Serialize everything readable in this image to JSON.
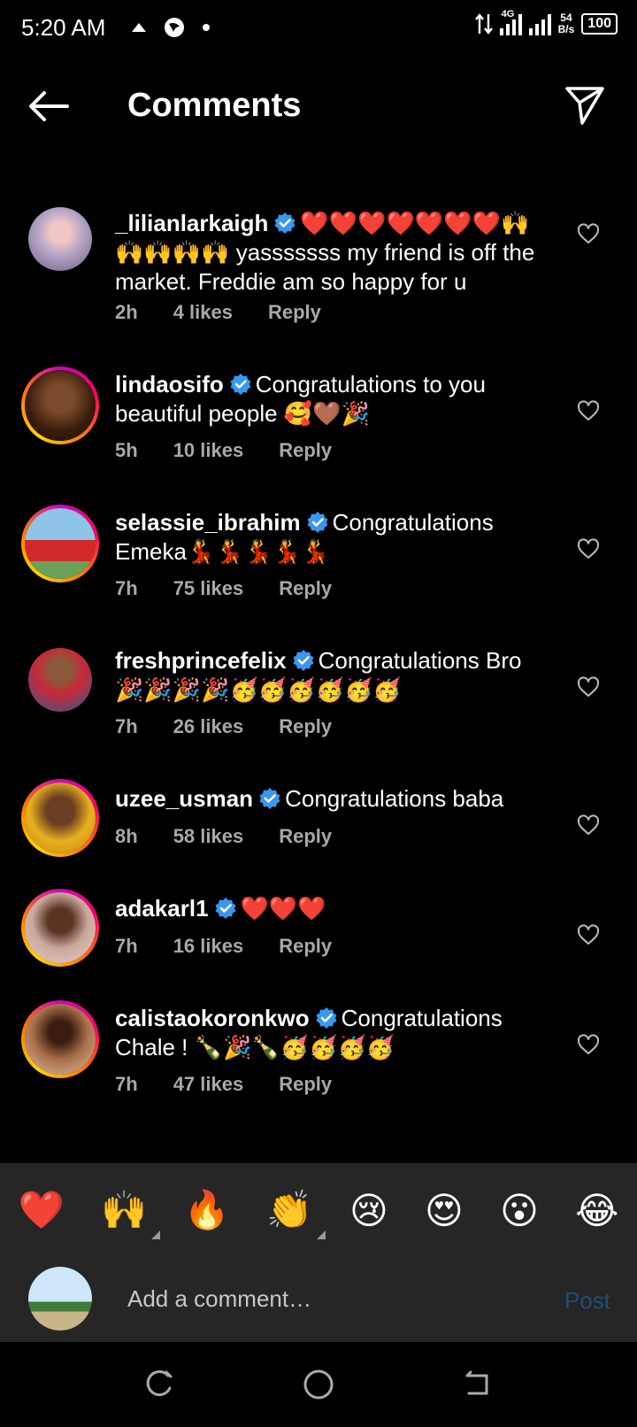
{
  "status_bar": {
    "time": "5:20 AM",
    "network": "4G",
    "speed_top": "54",
    "speed_bottom": "B/s",
    "battery": "100"
  },
  "header": {
    "title": "Comments",
    "back_icon": "arrow-left-icon",
    "share_icon": "paper-plane-icon"
  },
  "colors": {
    "verified": "#3897f0",
    "story_ring": "#d300c5",
    "reaction_bar": "#262626",
    "post": "#1d4d7a"
  },
  "comments": [
    {
      "username": "_lilianlarkaigh",
      "text": "❤️❤️❤️❤️❤️❤️❤️🙌🙌🙌🙌🙌 yasssssss my friend  is off the market. Freddie am so happy for u",
      "time": "2h",
      "likes": "4 likes",
      "reply": "Reply"
    },
    {
      "username": "lindaosifo",
      "text": "Congratulations to you beautiful people 🥰🤎🎉",
      "time": "5h",
      "likes": "10 likes",
      "reply": "Reply"
    },
    {
      "username": "selassie_ibrahim",
      "text": "Congratulations Emeka💃💃💃💃💃",
      "time": "7h",
      "likes": "75 likes",
      "reply": "Reply"
    },
    {
      "username": "freshprincefelix",
      "text": "Congratulations Bro 🎉🎉🎉🎉🥳🥳🥳🥳🥳🥳",
      "time": "7h",
      "likes": "26 likes",
      "reply": "Reply"
    },
    {
      "username": "uzee_usman",
      "text": "Congratulations baba",
      "time": "8h",
      "likes": "58 likes",
      "reply": "Reply"
    },
    {
      "username": "adakarl1",
      "text": "❤️❤️❤️",
      "time": "7h",
      "likes": "16 likes",
      "reply": "Reply"
    },
    {
      "username": "calistaokoronkwo",
      "text": "Congratulations Chale ! 🍾🎉🍾🥳🥳🥳🥳",
      "time": "7h",
      "likes": "47 likes",
      "reply": "Reply"
    }
  ],
  "reactions": [
    "❤️",
    "🙌",
    "🔥",
    "👏",
    "😢",
    "😍",
    "😮",
    "😂"
  ],
  "composer": {
    "placeholder": "Add a comment…",
    "post_label": "Post"
  }
}
